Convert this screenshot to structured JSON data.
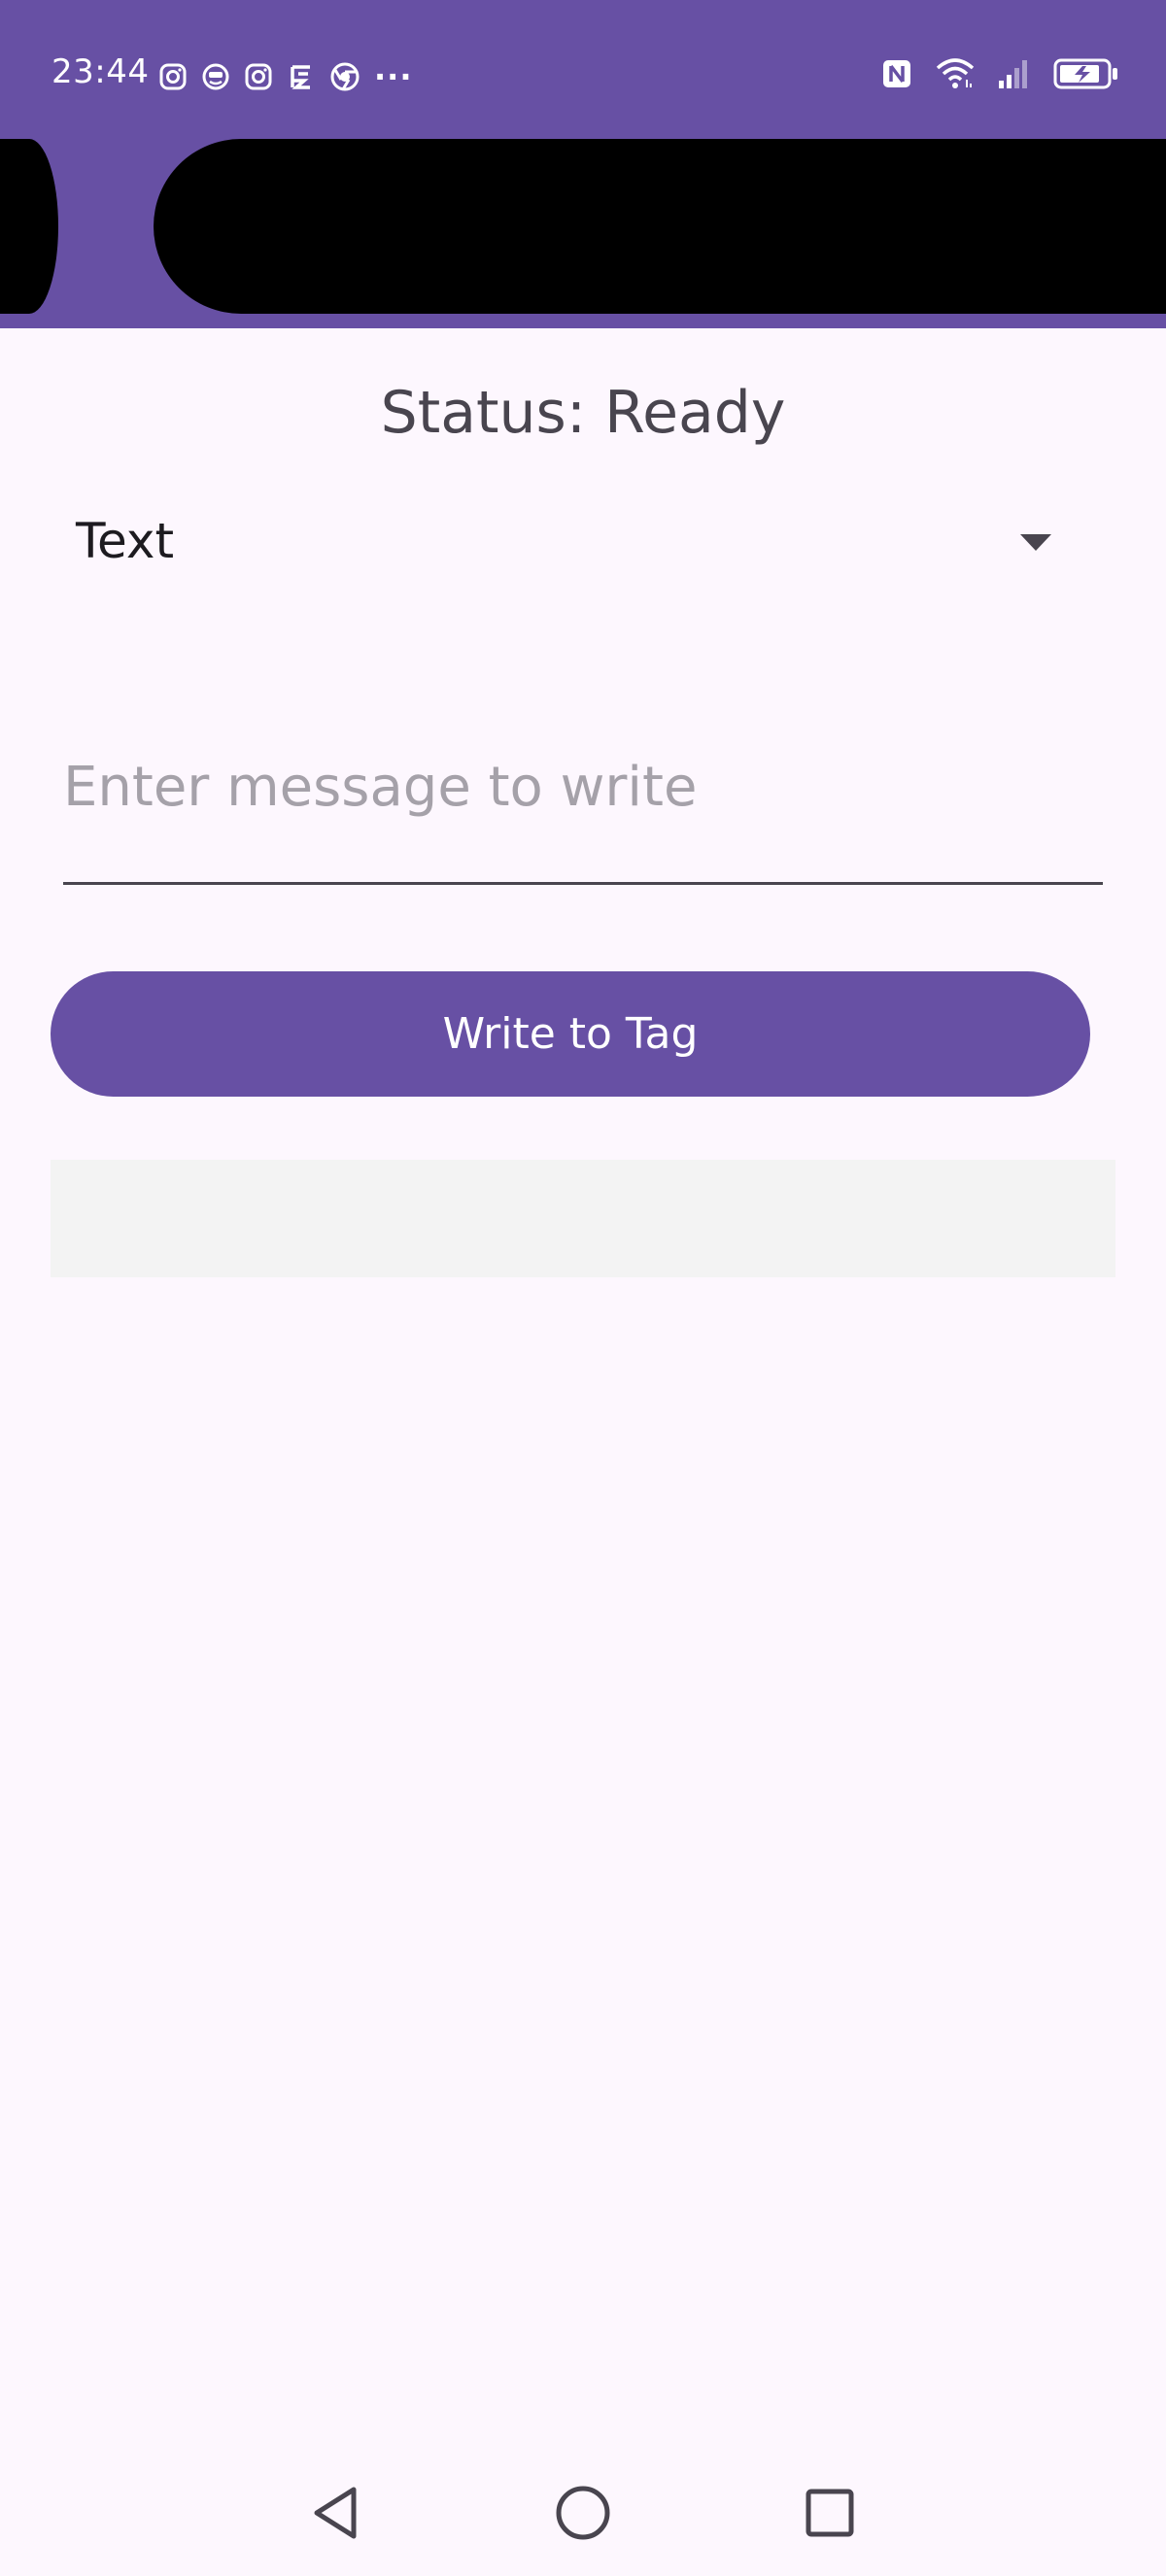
{
  "status_bar": {
    "time": "23:44",
    "notification_icons": [
      "instagram-icon",
      "app-face-icon",
      "instagram-icon",
      "stock-app-icon",
      "chrome-icon",
      "more-dots-icon"
    ],
    "system_icons": [
      "nfc-icon",
      "wifi-icon",
      "signal-icon",
      "battery-charging-icon"
    ],
    "more_label": "···"
  },
  "colors": {
    "primary": "#6750a4",
    "background": "#fdf7fe",
    "header_black": "#000000",
    "output_bg": "#f3f3f3"
  },
  "main": {
    "status_text": "Status: Ready",
    "type_dropdown": {
      "selected": "Text"
    },
    "message_input": {
      "value": "",
      "placeholder": "Enter message to write"
    },
    "write_button_label": "Write to Tag",
    "output_text": ""
  },
  "nav_bar": {
    "buttons": [
      "back-icon",
      "home-icon",
      "recents-icon"
    ]
  }
}
